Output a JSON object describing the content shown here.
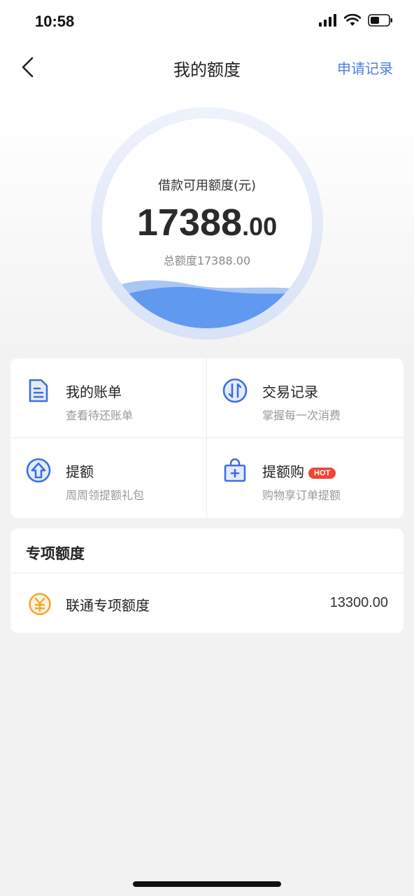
{
  "status_bar": {
    "time": "10:58"
  },
  "nav": {
    "title": "我的额度",
    "right_link": "申请记录"
  },
  "credit": {
    "label": "借款可用额度(元)",
    "amount_integer": "17388",
    "amount_decimal": ".00",
    "total_label": "总额度17388.00"
  },
  "grid": {
    "items": [
      {
        "title": "我的账单",
        "subtitle": "查看待还账单",
        "icon": "bill-icon"
      },
      {
        "title": "交易记录",
        "subtitle": "掌握每一次消费",
        "icon": "transaction-icon"
      },
      {
        "title": "提额",
        "subtitle": "周周领提额礼包",
        "icon": "raise-limit-icon"
      },
      {
        "title": "提额购",
        "subtitle": "购物享订单提额",
        "icon": "shopping-bag-icon",
        "badge": "HOT"
      }
    ]
  },
  "special": {
    "header": "专项额度",
    "items": [
      {
        "name": "联通专项额度",
        "amount": "13300.00",
        "icon": "yuan-coin-icon"
      }
    ]
  },
  "colors": {
    "accent_blue": "#4d7ee0",
    "icon_blue": "#3d6fe0",
    "hot_red": "#f04437",
    "coin_orange": "#f0a830"
  }
}
